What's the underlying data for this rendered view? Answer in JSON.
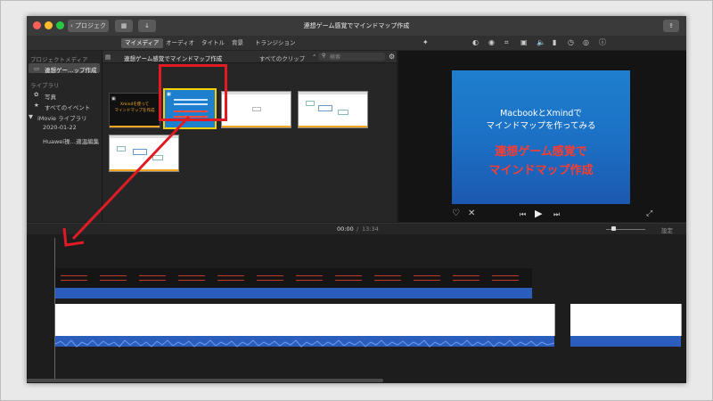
{
  "window": {
    "title": "連想ゲーム感覚でマインドマップ作成",
    "back_button": "プロジェクト"
  },
  "toolbar": {
    "tabs": [
      "マイメディア",
      "オーディオ",
      "タイトル",
      "背景",
      "トランジション"
    ],
    "active_tab": "マイメディア"
  },
  "sidebar": {
    "project_media_label": "プロジェクトメディア",
    "project_item": "連想ゲー…ップ作成",
    "library_label": "ライブラリ",
    "items": [
      "写真",
      "すべてのイベント",
      "iMovie ライブラリ",
      "2020-01-22",
      "Huawei操…適温編集"
    ]
  },
  "browser": {
    "title": "連想ゲーム感覚でマインドマップ作成",
    "filter": "すべてのクリップ",
    "search_placeholder": "検索",
    "clip1_line1": "Xmindを使って",
    "clip1_line2": "マインドマップを作成"
  },
  "viewer": {
    "slide_line1": "MacbookとXmindで",
    "slide_line2": "マインドマップを作ってみる",
    "slide_line3": "連想ゲーム感覚で",
    "slide_line4": "マインドマップ作成"
  },
  "timeline": {
    "current_time": "00:00",
    "separator": "/",
    "total_time": "13:34",
    "settings_label": "設定"
  },
  "colors": {
    "accent_red": "#e01b24",
    "slide_blue": "#1f7fcf",
    "audio_blue": "#2b5dbd"
  }
}
